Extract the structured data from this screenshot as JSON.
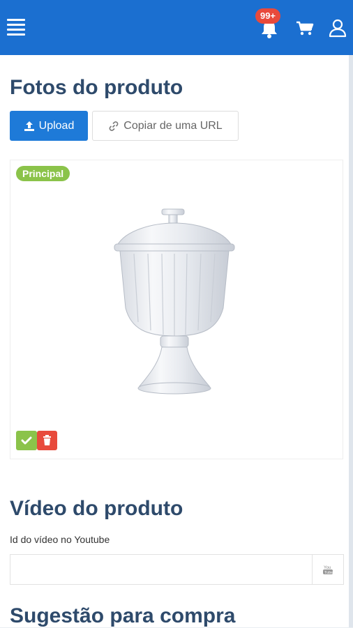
{
  "header": {
    "notification_count": "99+",
    "icons": [
      "menu-icon",
      "bell-icon",
      "cart-icon",
      "user-icon"
    ],
    "bg_color": "#1b6fd0"
  },
  "photos": {
    "title": "Fotos do produto",
    "upload_label": "Upload",
    "copy_url_label": "Copiar de uma URL",
    "items": [
      {
        "tag": "Principal",
        "image": "glass-candy-jar-with-lid"
      }
    ]
  },
  "video": {
    "title": "Vídeo do produto",
    "field_label": "Id do vídeo no Youtube",
    "value": "",
    "placeholder": ""
  },
  "suggestion": {
    "title": "Sugestão para compra"
  },
  "colors": {
    "primary": "#1e7ad8",
    "success": "#8bc34a",
    "danger": "#e84a3c",
    "heading": "#2e4a6b"
  }
}
